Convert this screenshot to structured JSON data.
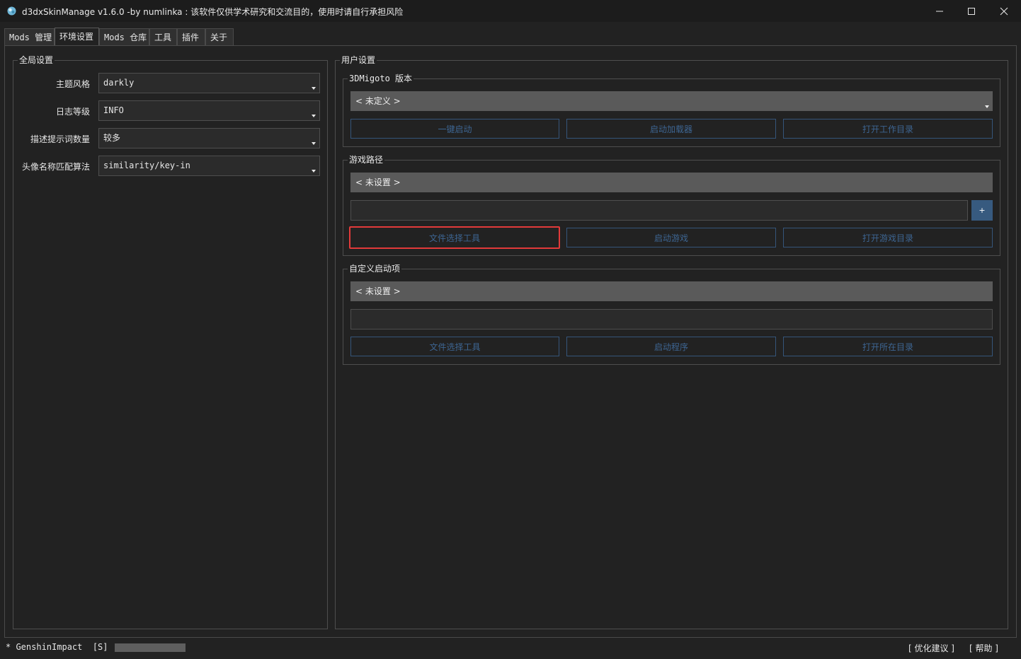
{
  "window": {
    "title": "d3dxSkinManage v1.6.0 -by numlinka : 该软件仅供学术研究和交流目的，使用时请自行承担风险"
  },
  "tabs": [
    {
      "label": "Mods 管理"
    },
    {
      "label": "环境设置"
    },
    {
      "label": "Mods 仓库"
    },
    {
      "label": "工具"
    },
    {
      "label": "插件"
    },
    {
      "label": "关于"
    }
  ],
  "global_settings": {
    "title": "全局设置",
    "rows": [
      {
        "label": "主题风格",
        "value": "darkly"
      },
      {
        "label": "日志等级",
        "value": "INFO"
      },
      {
        "label": "描述提示词数量",
        "value": "较多"
      },
      {
        "label": "头像名称匹配算法",
        "value": "similarity/key-in"
      }
    ]
  },
  "user_settings": {
    "title": "用户设置",
    "migoto": {
      "title": "3DMigoto 版本",
      "selected": "< 未定义 >",
      "buttons": [
        "一键启动",
        "启动加载器",
        "打开工作目录"
      ]
    },
    "game_path": {
      "title": "游戏路径",
      "value": "< 未设置 >",
      "add_label": "+",
      "buttons": [
        "文件选择工具",
        "启动游戏",
        "打开游戏目录"
      ]
    },
    "custom_launch": {
      "title": "自定义启动项",
      "value": "< 未设置 >",
      "buttons": [
        "文件选择工具",
        "启动程序",
        "打开所在目录"
      ]
    }
  },
  "status": {
    "left": "* GenshinImpact  [S]  -",
    "suggest": "[ 优化建议 ]",
    "help": "[ 帮助 ]"
  },
  "colors": {
    "background": "#222222",
    "titlebar": "#1c1c1c",
    "button_border": "#35557a",
    "button_text": "#3d6592",
    "accent": "#375a7f",
    "highlight": "#e23a3a"
  }
}
